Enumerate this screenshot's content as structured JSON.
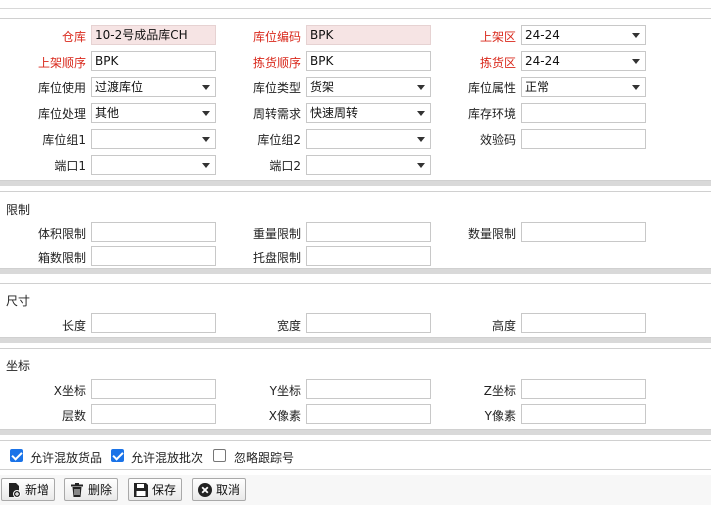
{
  "header": {
    "warehouse_label": "仓库",
    "warehouse_value": "10-2号成品库CH",
    "loc_code_label": "库位编码",
    "loc_code_value": "BPK",
    "putaway_zone_label": "上架区",
    "putaway_zone_value": "24-24",
    "putaway_seq_label": "上架顺序",
    "putaway_seq_value": "BPK",
    "pick_seq_label": "拣货顺序",
    "pick_seq_value": "BPK",
    "pick_zone_label": "拣货区",
    "pick_zone_value": "24-24",
    "loc_use_label": "库位使用",
    "loc_use_value": "过渡库位",
    "loc_type_label": "库位类型",
    "loc_type_value": "货架",
    "loc_attr_label": "库位属性",
    "loc_attr_value": "正常",
    "loc_proc_label": "库位处理",
    "loc_proc_value": "其他",
    "turnover_label": "周转需求",
    "turnover_value": "快速周转",
    "storage_env_label": "库存环境",
    "storage_env_value": "",
    "group1_label": "库位组1",
    "group1_value": "",
    "group2_label": "库位组2",
    "group2_value": "",
    "check_code_label": "效验码",
    "check_code_value": "",
    "port1_label": "端口1",
    "port1_value": "",
    "port2_label": "端口2",
    "port2_value": ""
  },
  "limits": {
    "title": "限制",
    "volume_label": "体积限制",
    "volume_value": "",
    "weight_label": "重量限制",
    "weight_value": "",
    "qty_label": "数量限制",
    "qty_value": "",
    "box_label": "箱数限制",
    "box_value": "",
    "pallet_label": "托盘限制",
    "pallet_value": ""
  },
  "size": {
    "title": "尺寸",
    "length_label": "长度",
    "length_value": "",
    "width_label": "宽度",
    "width_value": "",
    "height_label": "高度",
    "height_value": ""
  },
  "coords": {
    "title": "坐标",
    "x_label": "X坐标",
    "x_value": "",
    "y_label": "Y坐标",
    "y_value": "",
    "z_label": "Z坐标",
    "z_value": "",
    "layer_label": "层数",
    "layer_value": "",
    "xpx_label": "X像素",
    "xpx_value": "",
    "ypx_label": "Y像素",
    "ypx_value": ""
  },
  "options": {
    "mix_goods_label": "允许混放货品",
    "mix_goods_checked": true,
    "mix_batch_label": "允许混放批次",
    "mix_batch_checked": true,
    "ignore_track_label": "忽略跟踪号",
    "ignore_track_checked": false
  },
  "toolbar": {
    "new_label": "新增",
    "delete_label": "删除",
    "save_label": "保存",
    "cancel_label": "取消"
  }
}
